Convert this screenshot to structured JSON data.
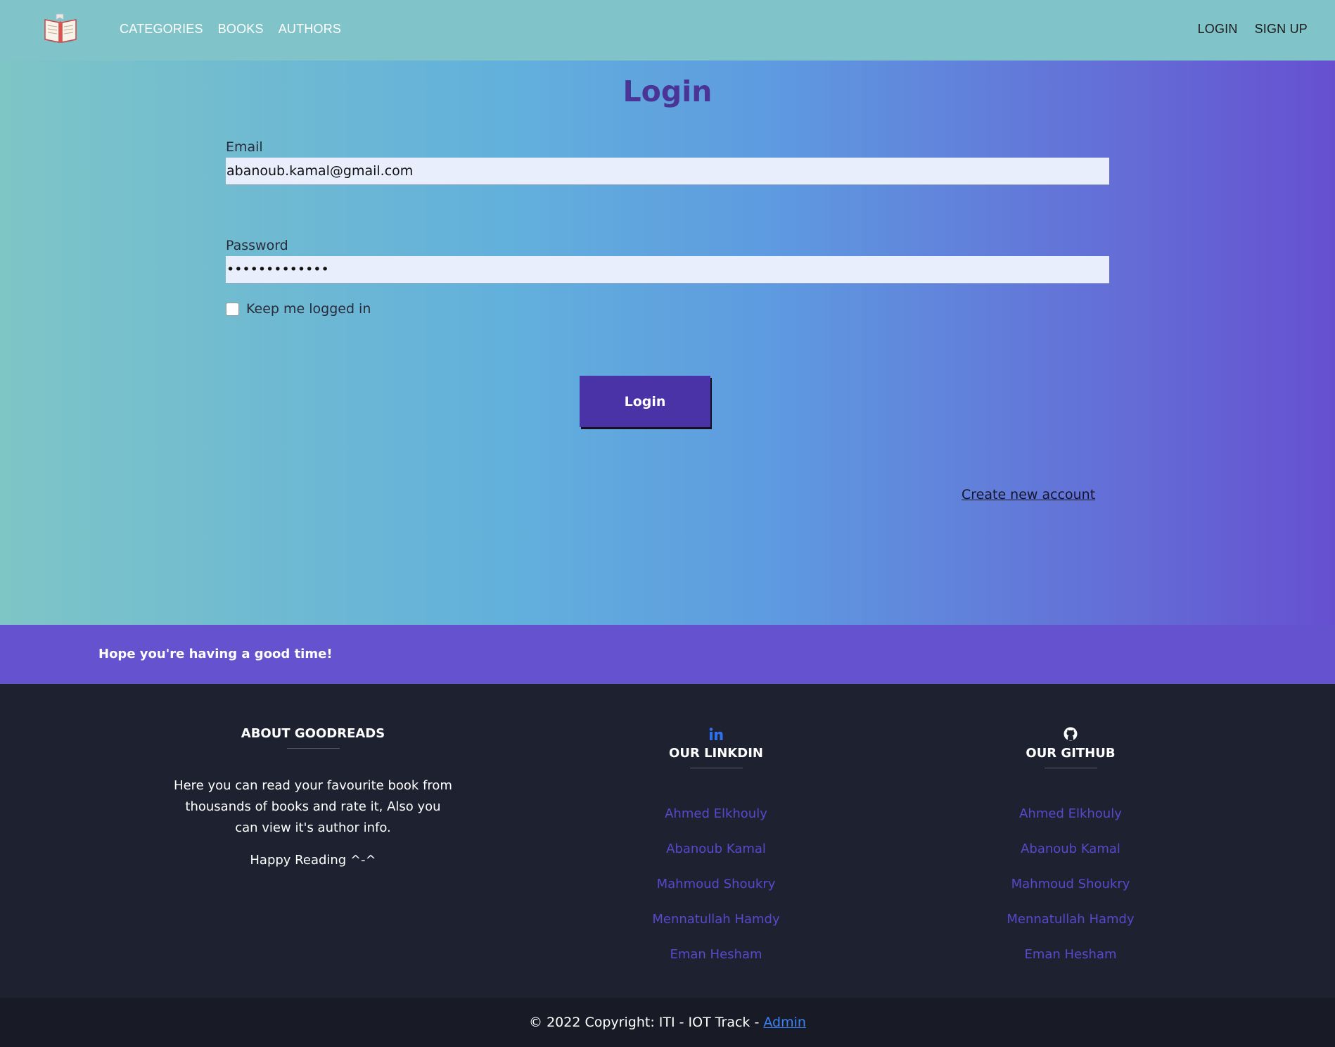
{
  "nav": {
    "logo_icon": "open-book-icon",
    "links": [
      "CATEGORIES",
      "BOOKS",
      "AUTHORS"
    ],
    "right": [
      "LOGIN",
      "SIGN UP"
    ]
  },
  "form": {
    "title": "Login",
    "email_label": "Email",
    "email_value": "abanoub.kamal@gmail.com",
    "password_label": "Password",
    "password_value": "•••••••••••••",
    "remember_label": "Keep me logged in",
    "remember_checked": false,
    "submit_label": "Login",
    "create_account": "Create new account"
  },
  "banner": {
    "text": "Hope you're having a good time!"
  },
  "footer": {
    "about": {
      "heading": "ABOUT GOODREADS",
      "text": "Here you can read your favourite book from thousands of books and rate it, Also you can view it's author info.",
      "happy": "Happy Reading ^-^"
    },
    "linkedin": {
      "icon": "linkedin-icon",
      "heading": "OUR LINKDIN",
      "names": [
        "Ahmed Elkhouly",
        "Abanoub Kamal",
        "Mahmoud Shoukry",
        "Mennatullah Hamdy",
        "Eman Hesham"
      ]
    },
    "github": {
      "icon": "github-icon",
      "heading": "OUR GITHUB",
      "names": [
        "Ahmed Elkhouly",
        "Abanoub Kamal",
        "Mahmoud Shoukry",
        "Mennatullah Hamdy",
        "Eman Hesham"
      ]
    },
    "copyright_text": "© 2022 Copyright: ITI - IOT Track - ",
    "admin_link": "Admin"
  },
  "colors": {
    "navbar": "#80c4c9",
    "title": "#4a3596",
    "button": "#4a33a6",
    "banner": "#6552cf",
    "footer": "#1e2230",
    "footer_link": "#5a47cc",
    "admin_link": "#3c82f6"
  }
}
